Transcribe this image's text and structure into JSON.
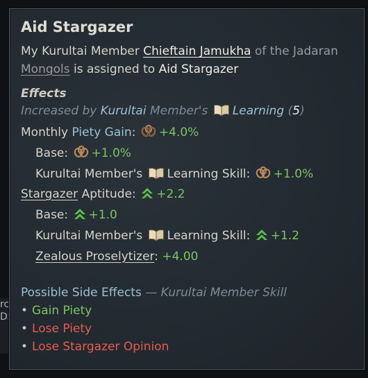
{
  "background_fragment": [
    "rc",
    "DS"
  ],
  "tooltip": {
    "title": "Aid Stargazer",
    "intro": {
      "p1": "My Kurultai Member",
      "member": "Chieftain Jamukha",
      "p2": "of the Jadaran",
      "p3": "Mongols",
      "p4": "is assigned to",
      "task": "Aid Stargazer"
    },
    "effects_header": "Effects",
    "increased_by": {
      "p1": "Increased by",
      "k1": "Kurultai",
      "p2": "Member's",
      "k2": "Learning",
      "open": "(",
      "val": "5",
      "close": ")"
    },
    "monthly": {
      "label": "Monthly",
      "piety": "Piety Gain",
      "colon": ":",
      "value": "+4.0%"
    },
    "base1": {
      "label": "Base:",
      "value": "+1.0%"
    },
    "skill1": {
      "p1": "Kurultai Member's",
      "p2": "Learning Skill:",
      "value": "+1.0%"
    },
    "aptitude": {
      "stargazer": "Stargazer",
      "label": "Aptitude:",
      "value": "+2.2"
    },
    "base2": {
      "label": "Base:",
      "value": "+1.0"
    },
    "skill2": {
      "p1": "Kurultai Member's",
      "p2": "Learning Skill:",
      "value": "+1.2"
    },
    "zealous": {
      "label": "Zealous Proselytizer",
      "colon": ":",
      "value": "+4.00"
    },
    "side_effects": {
      "label": "Possible Side Effects",
      "dash": "—",
      "source": "Kurultai Member Skill"
    },
    "side_items": [
      {
        "text": "Gain Piety",
        "color": "#7bc463"
      },
      {
        "text": "Lose Piety",
        "color": "#e85a4f"
      },
      {
        "text": "Lose Stargazer Opinion",
        "color": "#e85a4f"
      }
    ],
    "icons": {
      "piety": "piety-knot-icon",
      "learning": "open-book-icon",
      "aptitude": "green-chevron-up-icon"
    }
  }
}
